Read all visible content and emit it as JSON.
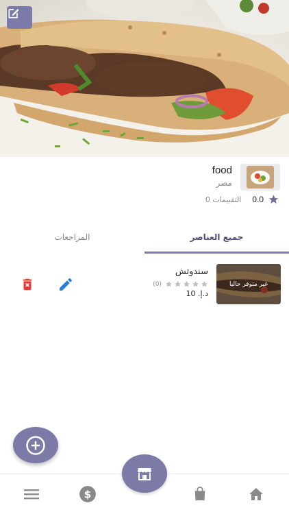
{
  "header": {
    "edit_icon": "edit-square-icon",
    "hero_image": "kofta-sandwich-photo"
  },
  "shop": {
    "name": "food",
    "country": "مصر",
    "rating": "0.0",
    "reviews_label": "0 التقييمات",
    "thumb_icon": "food-plate-image"
  },
  "tabs": {
    "all_items": "جميع العناصر",
    "reviews": "المراجعات",
    "active": "all_items"
  },
  "items": [
    {
      "name": "سندوتش",
      "badge": "غير متوفر حاليا",
      "rating_count": "(0)",
      "stars": 0,
      "price": "د.إ. 10"
    }
  ],
  "bottom_nav": {
    "items": [
      "menu-icon",
      "dollar-icon",
      "store-icon",
      "shopping-bag-icon",
      "home-icon"
    ]
  },
  "colors": {
    "accent": "#7c7aa6",
    "edit_blue": "#2680d9",
    "delete_red": "#e53935",
    "star_gray": "#bdbdbd",
    "nav_gray": "#8a8a8a"
  }
}
